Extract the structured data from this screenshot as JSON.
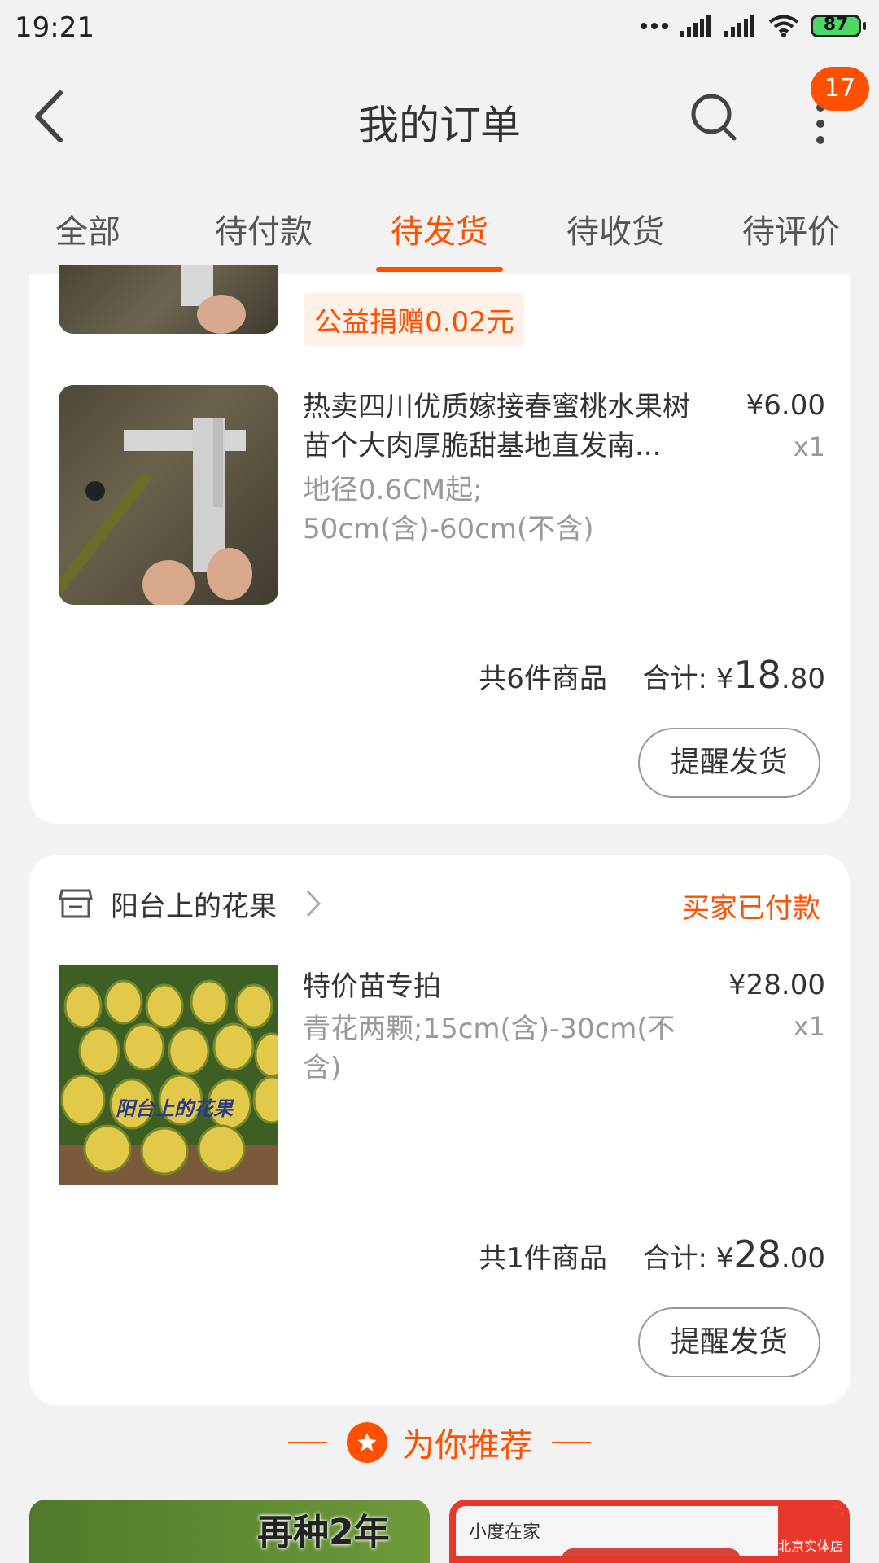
{
  "status_bar": {
    "time": "19:21",
    "battery": "87"
  },
  "nav": {
    "title": "我的订单",
    "badge_count": "17"
  },
  "tabs": [
    {
      "label": "全部"
    },
    {
      "label": "待付款"
    },
    {
      "label": "待发货",
      "active": true
    },
    {
      "label": "待收货"
    },
    {
      "label": "待评价"
    }
  ],
  "order1": {
    "donation_tag": "公益捐赠0.02元",
    "item": {
      "title": "热卖四川优质嫁接春蜜桃水果树苗个大肉厚脆甜基地直发南...",
      "spec_line1": "地径0.6CM起;",
      "spec_line2": "50cm(含)-60cm(不含)",
      "price": "¥6.00",
      "qty": "x1"
    },
    "summary": {
      "count_text": "共6件商品",
      "total_label": "合计: ",
      "currency": "¥",
      "total_int": "18",
      "total_dec": ".80"
    },
    "remind_button": "提醒发货"
  },
  "order2": {
    "shop_name": "阳台上的花果",
    "status": "买家已付款",
    "item": {
      "title": "特价苗专拍",
      "spec": "青花两颗;15cm(含)-30cm(不含)",
      "price": "¥28.00",
      "qty": "x1",
      "image_caption": "阳台上的花果"
    },
    "summary": {
      "count_text": "共1件商品",
      "total_label": "合计: ",
      "currency": "¥",
      "total_int": "28",
      "total_dec": ".00"
    },
    "remind_button": "提醒发货"
  },
  "recommend": {
    "title": "为你推荐",
    "card1_text": "再种2年",
    "card2_text1": "小度在家",
    "card2_text2": "北京实体店"
  },
  "colors": {
    "accent": "#ff5000",
    "background": "#f2f2f2"
  }
}
